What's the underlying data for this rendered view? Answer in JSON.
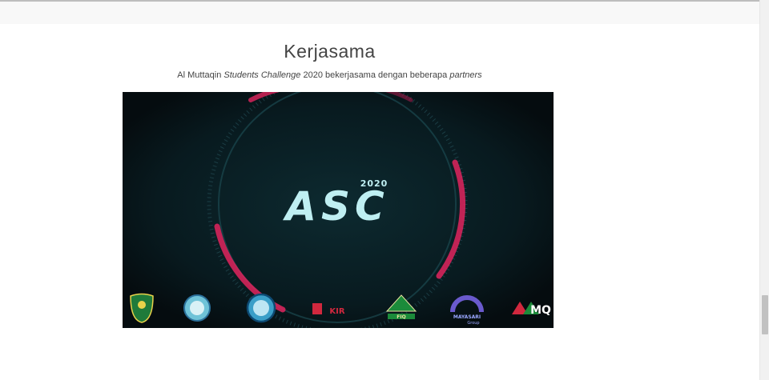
{
  "section": {
    "title": "Kerjasama",
    "subtitle_parts": {
      "p1": "Al Muttaqin ",
      "p2": "Students Challenge",
      "p3": " 2020 bekerjasama dengan beberapa ",
      "p4": "partners"
    }
  },
  "video": {
    "logo_text": "ASC",
    "logo_year": "2020",
    "partner_logos": [
      {
        "icon": "west-java-emblem-icon"
      },
      {
        "icon": "school-seal-icon"
      },
      {
        "icon": "school-seal-icon"
      },
      {
        "icon": "kir-logo-icon",
        "label": "KIR"
      },
      {
        "icon": "fiq-logo-icon",
        "label": "FIQ"
      },
      {
        "icon": "mayasari-logo-icon",
        "label": "MAYASARI",
        "sub": "Group"
      },
      {
        "icon": "amq-logo-icon",
        "label": "MQ"
      }
    ]
  },
  "colors": {
    "video_bg": "#071216",
    "ring_red": "#e0245e",
    "logo_cyan": "#bfeff2"
  }
}
